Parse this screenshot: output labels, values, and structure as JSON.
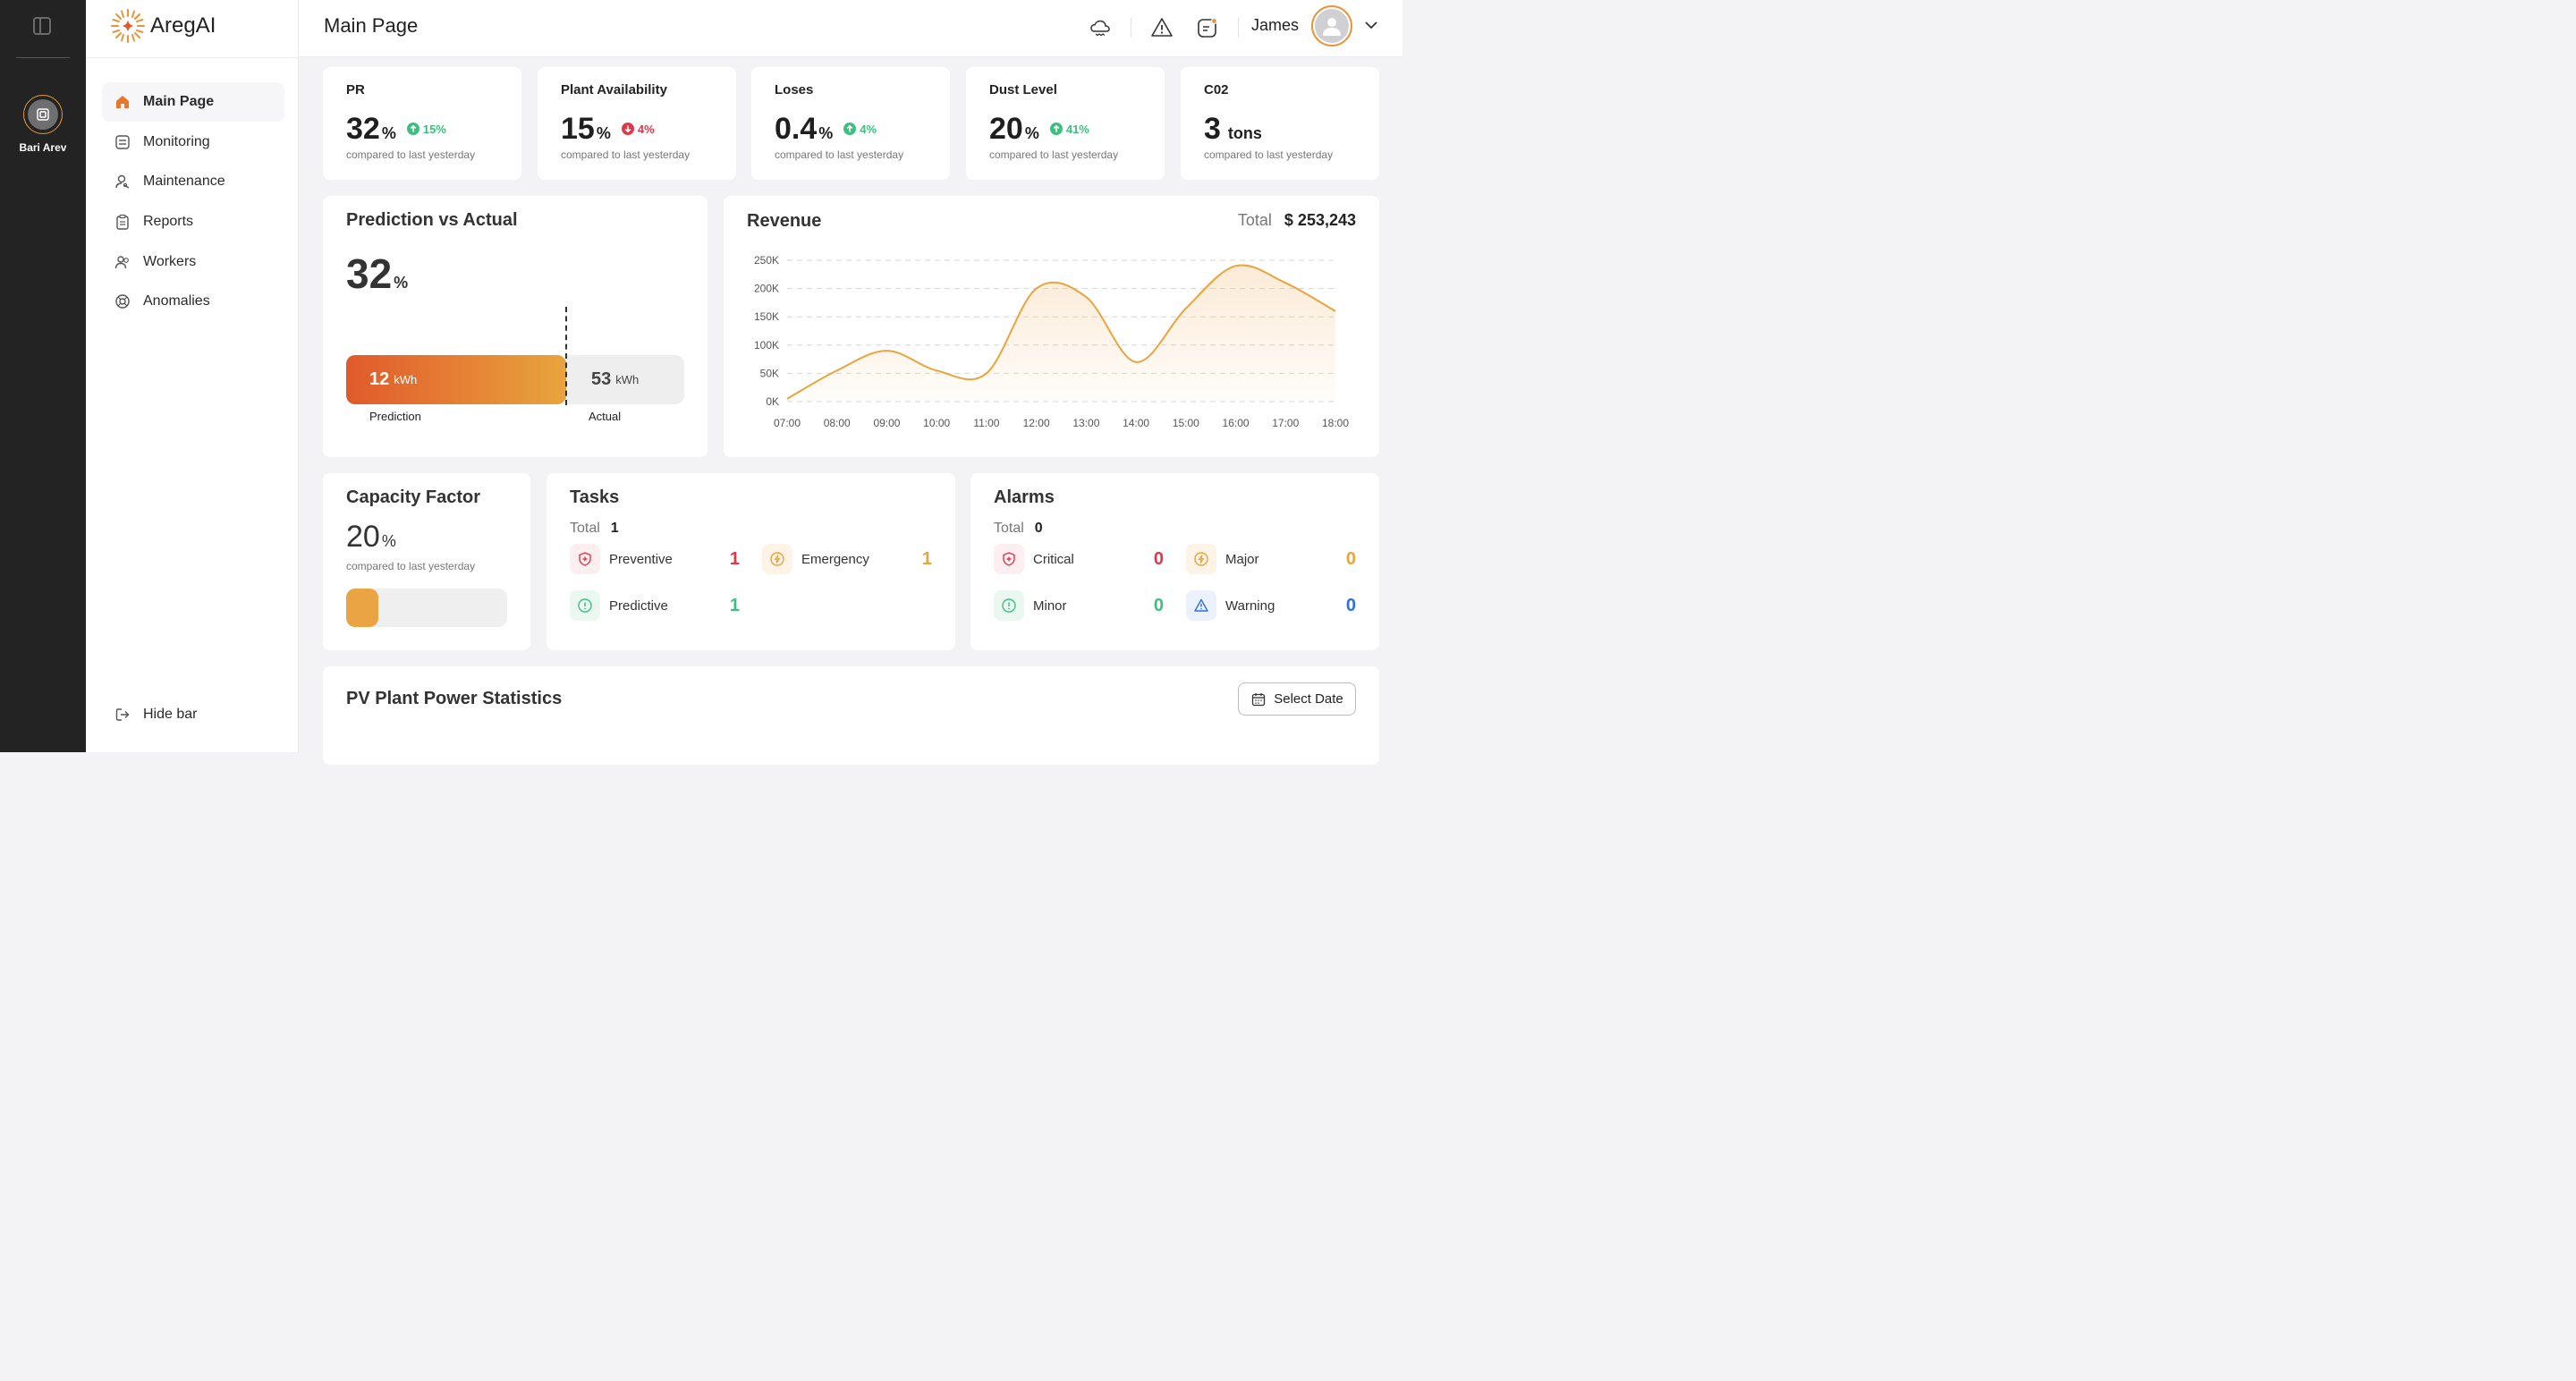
{
  "rail": {
    "user_name": "Bari Arev"
  },
  "brand": {
    "name": "AregAI"
  },
  "sidebar": {
    "items": [
      {
        "label": "Main Page",
        "icon": "home-icon"
      },
      {
        "label": "Monitoring",
        "icon": "monitor-icon"
      },
      {
        "label": "Maintenance",
        "icon": "maintenance-icon"
      },
      {
        "label": "Reports",
        "icon": "clipboard-icon"
      },
      {
        "label": "Workers",
        "icon": "users-icon"
      },
      {
        "label": "Anomalies",
        "icon": "anomaly-icon"
      }
    ],
    "hide_bar": "Hide bar"
  },
  "header": {
    "title": "Main Page",
    "user": "James",
    "icons": [
      "weather-icon",
      "warning-icon",
      "notification-icon",
      "chevron-down-icon"
    ]
  },
  "kpis": [
    {
      "title": "PR",
      "value": "32",
      "unit": "%",
      "delta": "15%",
      "trend": "up",
      "compare": "compared to last yesterday"
    },
    {
      "title": "Plant Availability",
      "value": "15",
      "unit": "%",
      "delta": "4%",
      "trend": "down",
      "compare": "compared to last yesterday"
    },
    {
      "title": "Loses",
      "value": "0.4",
      "unit": "%",
      "delta": "4%",
      "trend": "up",
      "compare": "compared to last yesterday"
    },
    {
      "title": "Dust Level",
      "value": "20",
      "unit": "%",
      "delta": "41%",
      "trend": "up",
      "compare": "compared to last yesterday"
    },
    {
      "title": "C02",
      "value": "3",
      "unit": "tons",
      "delta": "",
      "trend": "",
      "compare": "compared to last yesterday"
    }
  ],
  "prediction": {
    "title": "Prediction vs Actual",
    "percent": "32",
    "percent_unit": "%",
    "prediction_value": "12",
    "actual_value": "53",
    "unit": "kWh",
    "prediction_label": "Prediction",
    "actual_label": "Actual"
  },
  "revenue": {
    "title": "Revenue",
    "total_label": "Total",
    "total_value": "$ 253,243"
  },
  "chart_data": {
    "type": "area",
    "title": "Revenue",
    "xlabel": "",
    "ylabel": "",
    "x": [
      "07:00",
      "08:00",
      "09:00",
      "10:00",
      "11:00",
      "12:00",
      "13:00",
      "14:00",
      "15:00",
      "16:00",
      "17:00",
      "18:00"
    ],
    "series": [
      {
        "values": [
          5000,
          55000,
          90000,
          55000,
          50000,
          200000,
          185000,
          70000,
          165000,
          240000,
          210000,
          160000
        ]
      }
    ],
    "y_ticks": [
      "0K",
      "50K",
      "100K",
      "150K",
      "200K",
      "250K"
    ],
    "ylim": [
      0,
      250000
    ],
    "grid": true,
    "color": "#e9a43d"
  },
  "capacity": {
    "title": "Capacity Factor",
    "value": "20",
    "unit": "%",
    "compare": "compared to last yesterday",
    "fill_fraction": 0.2
  },
  "tasks": {
    "title": "Tasks",
    "total_label": "Total",
    "total": "1",
    "items": [
      {
        "label": "Preventive",
        "value": "1",
        "icon": "shield-icon",
        "color": "#e0384a",
        "bg": "#fdeef0"
      },
      {
        "label": "Emergency",
        "value": "1",
        "icon": "bolt-icon",
        "color": "#e9a43d",
        "bg": "#fdf3e6"
      },
      {
        "label": "Predictive",
        "value": "1",
        "icon": "alert-circle-icon",
        "color": "#3fbf7f",
        "bg": "#eaf8f1"
      }
    ]
  },
  "alarms": {
    "title": "Alarms",
    "total_label": "Total",
    "total": "0",
    "items": [
      {
        "label": "Critical",
        "value": "0",
        "icon": "shield-icon",
        "color": "#e0384a",
        "bg": "#fdeef0"
      },
      {
        "label": "Major",
        "value": "0",
        "icon": "bolt-icon",
        "color": "#e9a43d",
        "bg": "#fdf3e6"
      },
      {
        "label": "Minor",
        "value": "0",
        "icon": "alert-circle-icon",
        "color": "#3fbf7f",
        "bg": "#eaf8f1"
      },
      {
        "label": "Warning",
        "value": "0",
        "icon": "warning-icon",
        "color": "#2f6fe0",
        "bg": "#ebf1fd"
      }
    ]
  },
  "pv_stats": {
    "title": "PV Plant Power Statistics",
    "select_date": "Select Date"
  }
}
